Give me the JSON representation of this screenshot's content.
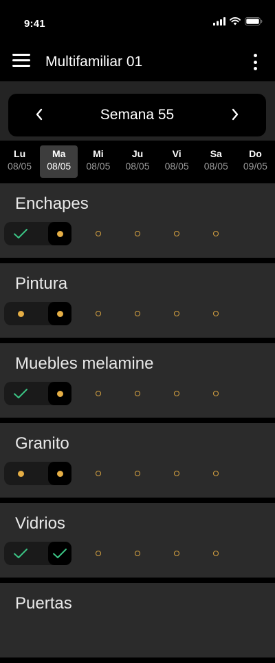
{
  "status": {
    "time": "9:41"
  },
  "app_bar": {
    "title": "Multifamiliar 01"
  },
  "week": {
    "label": "Semana 55"
  },
  "days": [
    {
      "name": "Lu",
      "date": "08/05",
      "selected": false
    },
    {
      "name": "Ma",
      "date": "08/05",
      "selected": true
    },
    {
      "name": "Mi",
      "date": "08/05",
      "selected": false
    },
    {
      "name": "Ju",
      "date": "08/05",
      "selected": false
    },
    {
      "name": "Vi",
      "date": "08/05",
      "selected": false
    },
    {
      "name": "Sa",
      "date": "08/05",
      "selected": false
    },
    {
      "name": "Do",
      "date": "09/05",
      "selected": false
    }
  ],
  "colors": {
    "check": "#3bc585",
    "pending_dot": "#e5ae45",
    "upcoming_ring": "#d9a441"
  },
  "tasks": [
    {
      "name": "Enchapes",
      "days": [
        "check",
        "dot",
        "ring",
        "ring",
        "ring",
        "ring"
      ]
    },
    {
      "name": "Pintura",
      "days": [
        "dot",
        "dot",
        "ring",
        "ring",
        "ring",
        "ring"
      ]
    },
    {
      "name": "Muebles melamine",
      "days": [
        "check",
        "dot",
        "ring",
        "ring",
        "ring",
        "ring"
      ]
    },
    {
      "name": "Granito",
      "days": [
        "dot",
        "dot",
        "ring",
        "ring",
        "ring",
        "ring"
      ]
    },
    {
      "name": "Vidrios",
      "days": [
        "check",
        "check",
        "ring",
        "ring",
        "ring",
        "ring"
      ]
    },
    {
      "name": "Puertas",
      "days": []
    }
  ]
}
